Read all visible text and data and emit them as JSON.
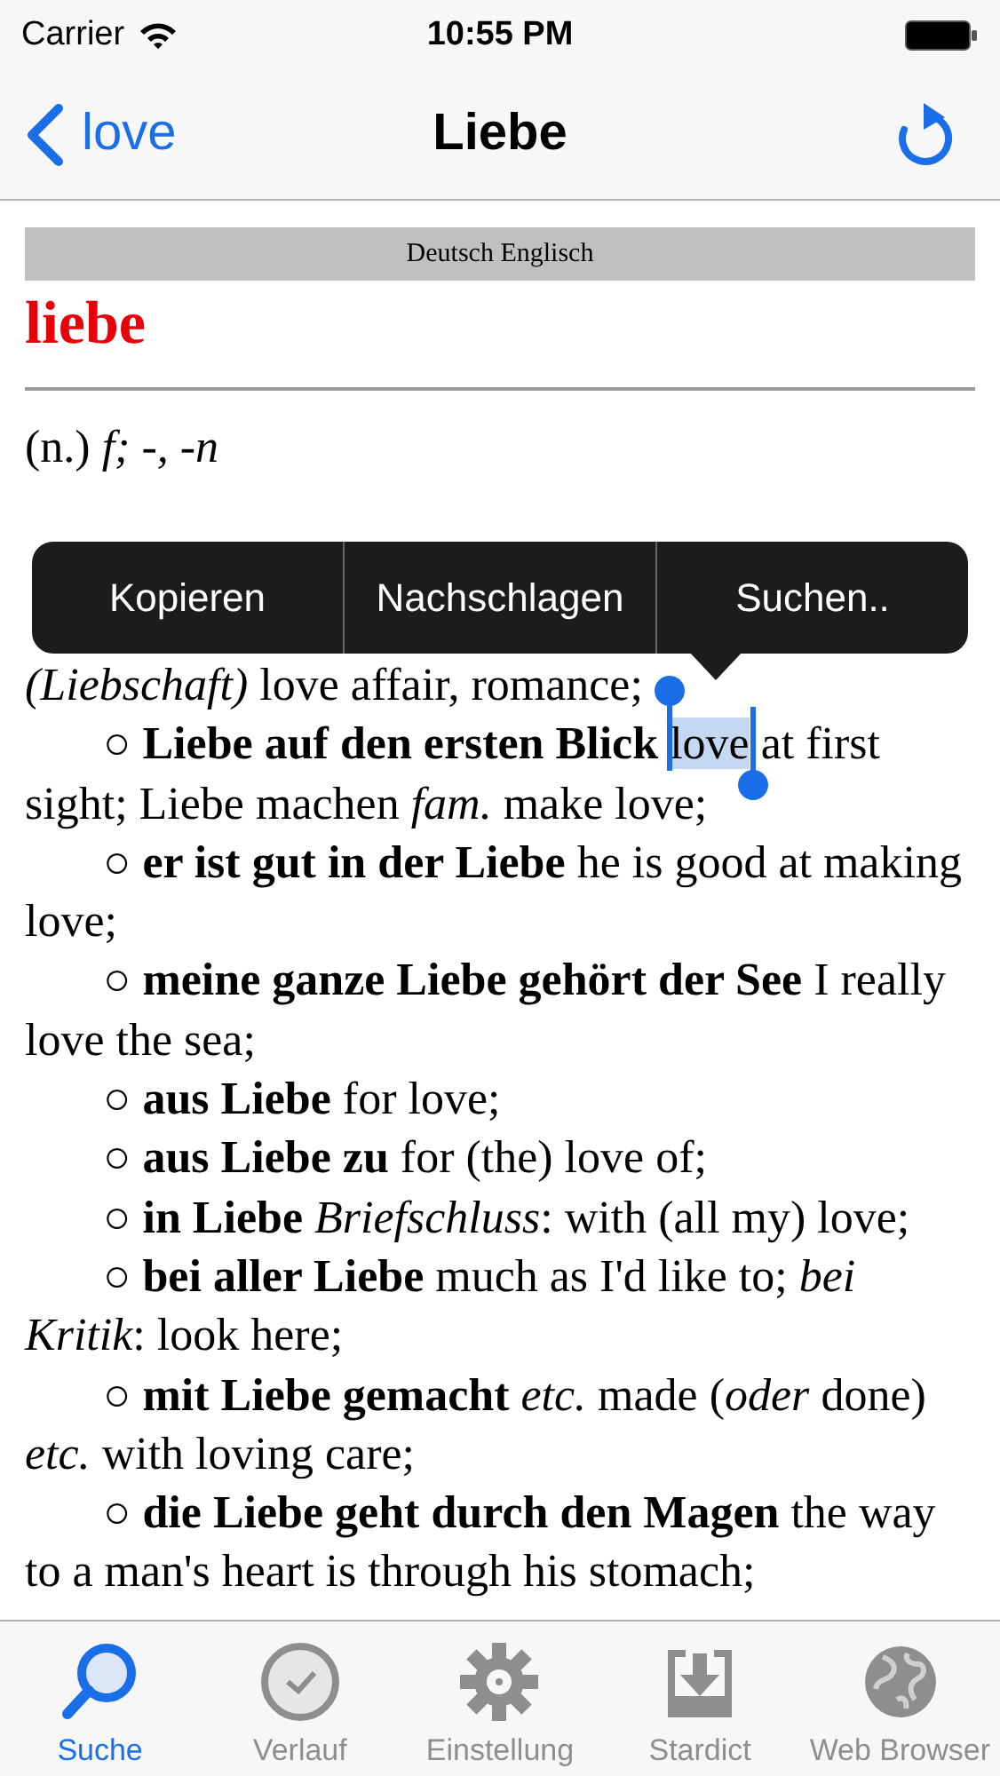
{
  "status_bar": {
    "carrier": "Carrier",
    "time": "10:55 PM"
  },
  "nav": {
    "back": "love",
    "title": "Liebe"
  },
  "entry": {
    "language_bar": "Deutsch Englisch",
    "headword": "liebe",
    "grammar": "(n.) *f; -, -n*",
    "senses": [
      {
        "kind": "plain",
        "text": "*(Liebschaft)* love affair, romance;"
      },
      {
        "kind": "bullet",
        "marker": "○",
        "text": "**Liebe auf den ersten Blick**",
        "selection": "love",
        "text_after": "at first sight; Liebe machen *fam.* make love;"
      },
      {
        "kind": "bullet",
        "marker": "○",
        "text": "**er ist gut in der Liebe** he is good at making love;"
      },
      {
        "kind": "bullet",
        "marker": "○",
        "text": "**meine ganze Liebe gehört der See** I really love the sea;"
      },
      {
        "kind": "bullet",
        "marker": "○",
        "text": "**aus Liebe** for love;"
      },
      {
        "kind": "bullet",
        "marker": "○",
        "text": "**aus Liebe zu** for (the) love of;"
      },
      {
        "kind": "bullet",
        "marker": "○",
        "text": "**in Liebe** *Briefschluss*: with (all my) love;"
      },
      {
        "kind": "bullet",
        "marker": "○",
        "text": "**bei aller Liebe** much as I'd like to; *bei Kritik*: look here;"
      },
      {
        "kind": "bullet",
        "marker": "○",
        "text": "**mit Liebe gemacht** *etc.* made (*oder* done) *etc.* with loving care;"
      },
      {
        "kind": "bullet",
        "marker": "○",
        "text": "**die Liebe geht durch den Magen** the way to a man's heart is through his stomach;"
      }
    ]
  },
  "context_menu": [
    "Kopieren",
    "Nachschlagen",
    "Suchen.."
  ],
  "tabs": [
    {
      "label": "Suche",
      "selected": true
    },
    {
      "label": "Verlauf",
      "selected": false
    },
    {
      "label": "Einstellung",
      "selected": false
    },
    {
      "label": "Stardict",
      "selected": false
    },
    {
      "label": "Web Browser",
      "selected": false
    }
  ]
}
